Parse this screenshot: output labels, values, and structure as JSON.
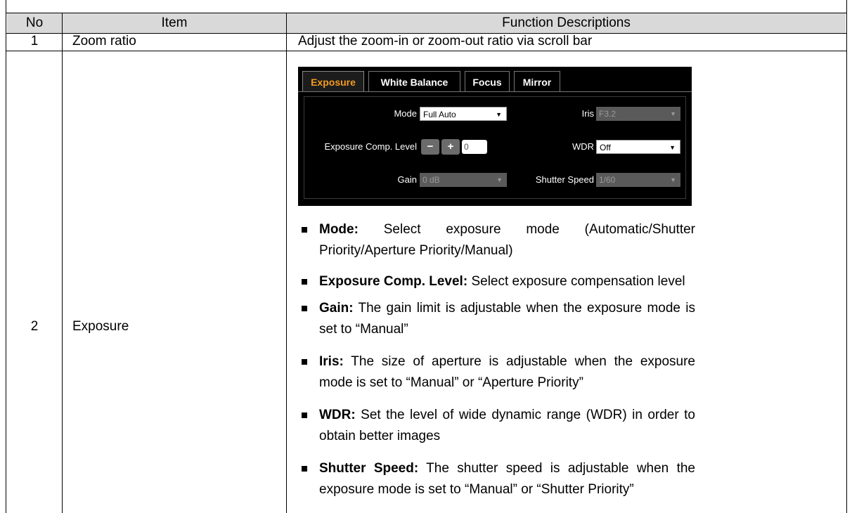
{
  "table": {
    "headers": {
      "no": "No",
      "item": "Item",
      "desc": "Function Descriptions"
    },
    "row1": {
      "no": "1",
      "item": "Zoom ratio",
      "desc": "Adjust the zoom-in or zoom-out ratio via scroll bar"
    },
    "row2": {
      "no": "2",
      "item": "Exposure"
    }
  },
  "panel": {
    "tabs": [
      "Exposure",
      "White Balance",
      "Focus",
      "Mirror"
    ],
    "active_tab": "Exposure",
    "mode_label": "Mode",
    "mode_value": "Full Auto",
    "iris_label": "Iris",
    "iris_value": "F3.2",
    "comp_label": "Exposure Comp. Level",
    "minus": "−",
    "plus": "+",
    "comp_value": "0",
    "wdr_label": "WDR",
    "wdr_value": "Off",
    "gain_label": "Gain",
    "gain_value": "0 dB",
    "shutter_label": "Shutter Speed",
    "shutter_value": "1/60",
    "arrow": "▼"
  },
  "bullets": [
    {
      "term": "Mode:",
      "text": " Select exposure mode (Automatic/Shutter Priority/Aperture Priority/Manual)"
    },
    {
      "term": "Exposure Comp. Level:",
      "text": " Select exposure compensation level"
    },
    {
      "term": "Gain:",
      "text": " The gain limit is adjustable when the exposure mode is set to “Manual”"
    },
    {
      "term": "Iris:",
      "text": " The size of aperture is adjustable when the exposure mode is set to “Manual” or “Aperture Priority”"
    },
    {
      "term": "WDR:",
      "text": " Set the level of wide dynamic range (WDR) in order to obtain better images"
    },
    {
      "term": "Shutter Speed:",
      "text": " The shutter speed is adjustable when the exposure mode is set to “Manual” or “Shutter Priority”"
    }
  ],
  "colors": {
    "header_bg": "#d9d9d9",
    "active_tab": "#f39c1f"
  }
}
